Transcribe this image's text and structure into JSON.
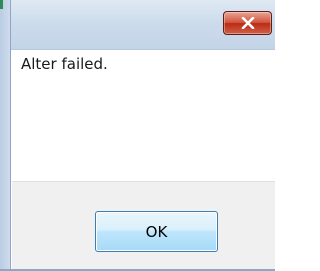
{
  "dialog": {
    "message": "Alter failed.",
    "ok_label": "OK",
    "close_icon": "close-icon"
  },
  "colors": {
    "close_button": "#c9452d",
    "ok_button_border": "#3c7fb1",
    "titlebar": "#cddcec"
  }
}
